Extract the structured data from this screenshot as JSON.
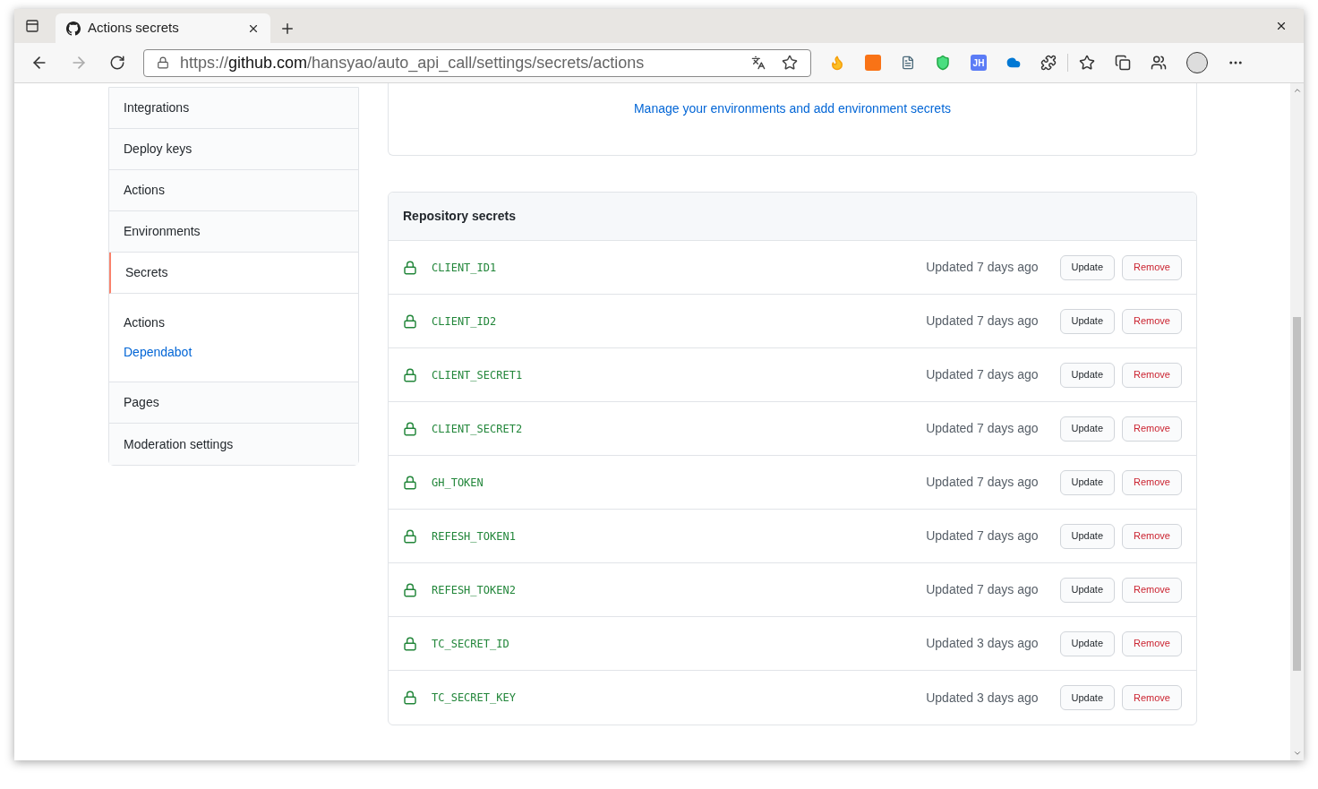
{
  "browser": {
    "tab": {
      "title": "Actions secrets",
      "selected": true
    },
    "address": {
      "scheme": "https://",
      "host": "github.com",
      "path": "/hansyao/auto_api_call/settings/secrets/actions"
    },
    "extensions": [
      {
        "kind": "flame"
      },
      {
        "kind": "orange"
      },
      {
        "kind": "doc"
      },
      {
        "kind": "shield"
      },
      {
        "kind": "badge",
        "label": "JH"
      },
      {
        "kind": "cloud"
      },
      {
        "kind": "puzzle"
      }
    ]
  },
  "sidebar": {
    "items": [
      {
        "kind": "item",
        "label": "Integrations",
        "selected": false
      },
      {
        "kind": "item",
        "label": "Deploy keys",
        "selected": false
      },
      {
        "kind": "item",
        "label": "Actions",
        "selected": false
      },
      {
        "kind": "item",
        "label": "Environments",
        "selected": false
      },
      {
        "kind": "item",
        "label": "Secrets",
        "selected": true
      },
      {
        "kind": "group",
        "children": [
          {
            "label": "Actions",
            "selected": true
          },
          {
            "label": "Dependabot",
            "selected": false
          }
        ]
      },
      {
        "kind": "item",
        "label": "Pages",
        "selected": false
      },
      {
        "kind": "item",
        "label": "Moderation settings",
        "selected": false
      }
    ]
  },
  "environments": {
    "link": "Manage your environments and add environment secrets"
  },
  "secrets": {
    "title": "Repository secrets",
    "rows": [
      {
        "name": "CLIENT_ID1",
        "updated": "Updated 7 days ago",
        "update": "Update",
        "remove": "Remove"
      },
      {
        "name": "CLIENT_ID2",
        "updated": "Updated 7 days ago",
        "update": "Update",
        "remove": "Remove"
      },
      {
        "name": "CLIENT_SECRET1",
        "updated": "Updated 7 days ago",
        "update": "Update",
        "remove": "Remove"
      },
      {
        "name": "CLIENT_SECRET2",
        "updated": "Updated 7 days ago",
        "update": "Update",
        "remove": "Remove"
      },
      {
        "name": "GH_TOKEN",
        "updated": "Updated 7 days ago",
        "update": "Update",
        "remove": "Remove"
      },
      {
        "name": "REFESH_TOKEN1",
        "updated": "Updated 7 days ago",
        "update": "Update",
        "remove": "Remove"
      },
      {
        "name": "REFESH_TOKEN2",
        "updated": "Updated 7 days ago",
        "update": "Update",
        "remove": "Remove"
      },
      {
        "name": "TC_SECRET_ID",
        "updated": "Updated 3 days ago",
        "update": "Update",
        "remove": "Remove"
      },
      {
        "name": "TC_SECRET_KEY",
        "updated": "Updated 3 days ago",
        "update": "Update",
        "remove": "Remove"
      }
    ]
  }
}
